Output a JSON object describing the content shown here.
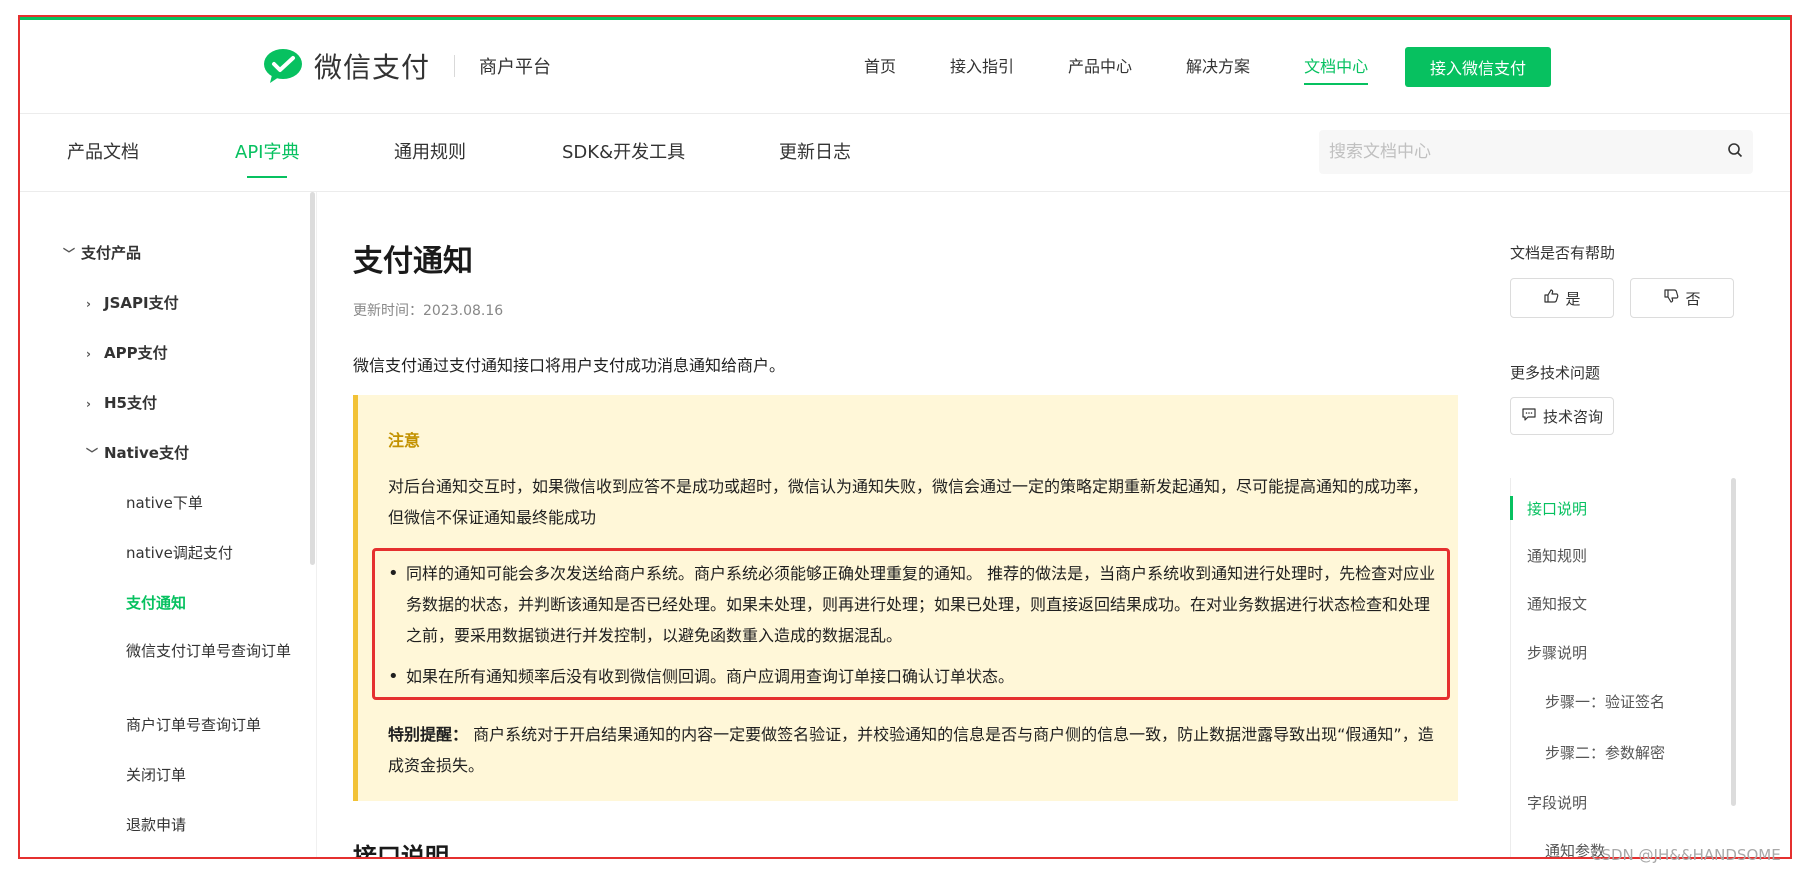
{
  "header": {
    "brand": "微信支付",
    "sub_brand": "商户平台",
    "nav": [
      "首页",
      "接入指引",
      "产品中心",
      "解决方案",
      "文档中心"
    ],
    "cta": "接入微信支付"
  },
  "subnav": {
    "tabs": [
      "产品文档",
      "API字典",
      "通用规则",
      "SDK&开发工具",
      "更新日志"
    ],
    "search_placeholder": "搜索文档中心"
  },
  "sidebar": {
    "section": "支付产品",
    "groups": [
      "JSAPI支付",
      "APP支付",
      "H5支付",
      "Native支付"
    ],
    "native_items": [
      "native下单",
      "native调起支付",
      "支付通知",
      "微信支付订单号查询订单",
      "商户订单号查询订单",
      "关闭订单",
      "退款申请"
    ]
  },
  "main": {
    "title": "支付通知",
    "updated": "更新时间：2023.08.16",
    "intro": "微信支付通过支付通知接口将用户支付成功消息通知给商户。",
    "notice": {
      "title": "注意",
      "paragraph": "对后台通知交互时，如果微信收到应答不是成功或超时，微信认为通知失败，微信会通过一定的策略定期重新发起通知，尽可能提高通知的成功率，但微信不保证通知最终能成功",
      "bullets": [
        "同样的通知可能会多次发送给商户系统。商户系统必须能够正确处理重复的通知。 推荐的做法是，当商户系统收到通知进行处理时，先检查对应业务数据的状态，并判断该通知是否已经处理。如果未处理，则再进行处理；如果已处理，则直接返回结果成功。在对业务数据进行状态检查和处理之前，要采用数据锁进行并发控制，以避免函数重入造成的数据混乱。",
        "如果在所有通知频率后没有收到微信侧回调。商户应调用查询订单接口确认订单状态。"
      ],
      "remark_label": "特别提醒：",
      "remark_text": "商户系统对于开启结果通知的内容一定要做签名验证，并校验通知的信息是否与商户侧的信息一致，防止数据泄露导致出现“假通知”，造成资金损失。"
    },
    "next_heading": "接口说明"
  },
  "rail": {
    "helpful_label": "文档是否有帮助",
    "yes": "是",
    "no": "否",
    "more_label": "更多技术问题",
    "consult": "技术咨询",
    "toc": [
      "接口说明",
      "通知规则",
      "通知报文",
      "步骤说明",
      "步骤一：验证签名",
      "步骤二：参数解密",
      "字段说明",
      "通知参数"
    ]
  },
  "watermark": "CSDN @JH&&HANDSOME",
  "colors": {
    "brand_green": "#07c160",
    "notice_bg": "#fff7d8",
    "notice_border": "#f2c236",
    "highlight_red": "#e5302f"
  }
}
